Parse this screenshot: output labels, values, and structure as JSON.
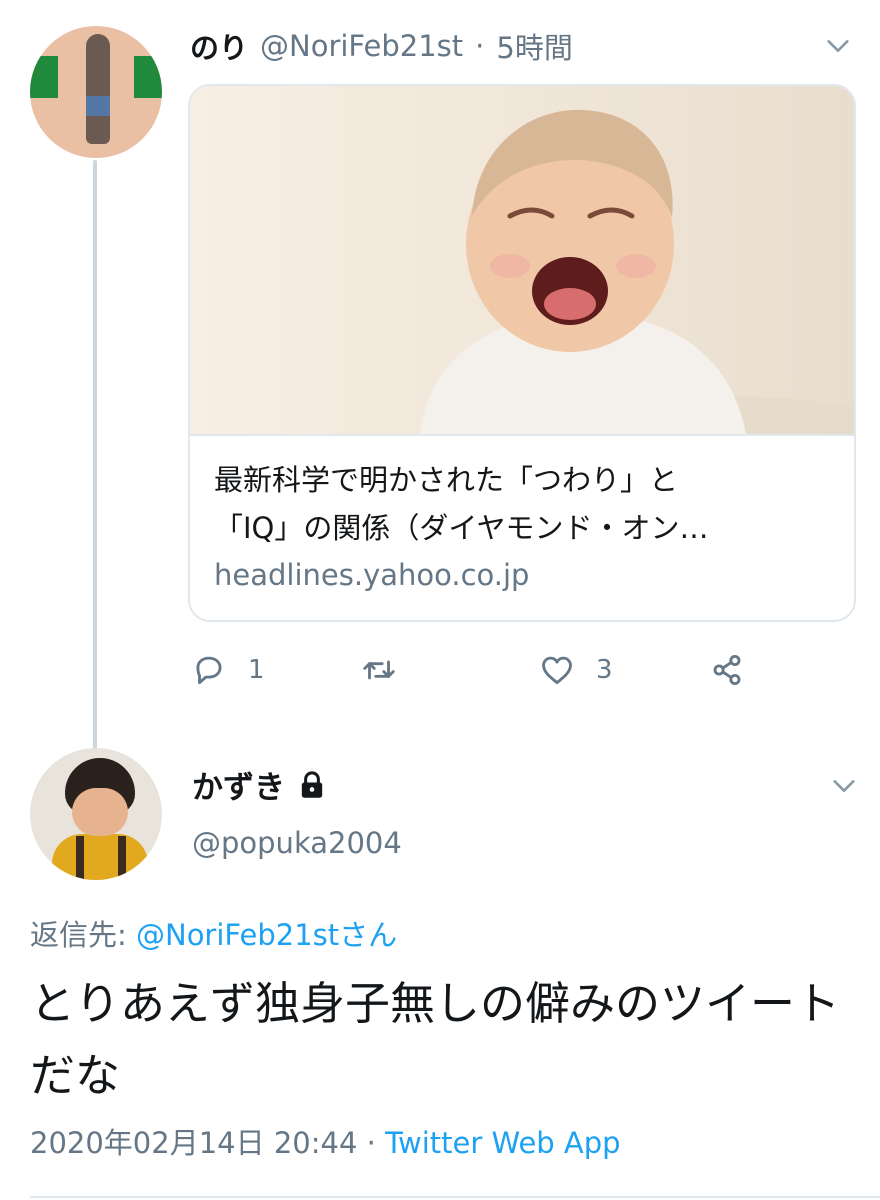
{
  "tweet1": {
    "display_name": "のり",
    "handle": "@NoriFeb21st",
    "separator": "·",
    "time": "5時間",
    "card": {
      "title_line1": "最新科学で明かされた「つわり」と",
      "title_line2": "「IQ」の関係（ダイヤモンド・オン…",
      "domain": "headlines.yahoo.co.jp"
    },
    "actions": {
      "reply_count": "1",
      "retweet_count": "",
      "like_count": "3"
    }
  },
  "tweet2": {
    "display_name": "かずき",
    "handle": "@popuka2004",
    "reply_prefix": "返信先: ",
    "reply_to": "@NoriFeb21stさん",
    "text": "とりあえず独身子無しの僻みのツイートだな",
    "timestamp": "2020年02月14日 20:44",
    "separator": "·",
    "source": "Twitter Web App"
  },
  "colors": {
    "link": "#1da1f2",
    "secondary_text": "#657786",
    "thread_line": "#ccd6dd"
  },
  "icons": [
    "chevron-down-icon",
    "reply-icon",
    "retweet-icon",
    "like-icon",
    "share-icon",
    "lock-icon"
  ]
}
